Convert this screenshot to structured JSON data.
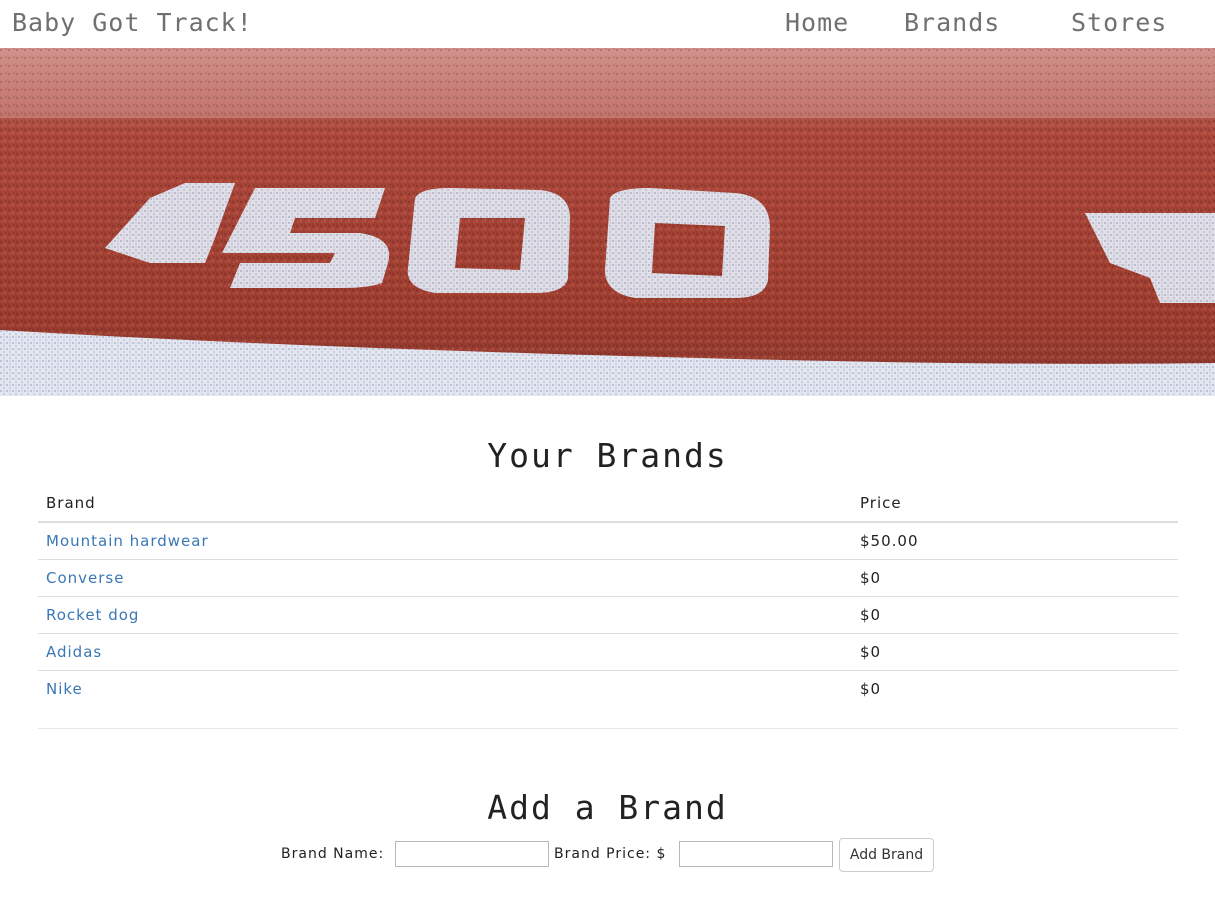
{
  "navbar": {
    "title": "Baby Got Track!",
    "links": [
      {
        "label": "Home"
      },
      {
        "label": "Brands"
      },
      {
        "label": "Stores"
      }
    ]
  },
  "hero": {
    "track_number": "1500",
    "colors": {
      "track": "#a84b3e",
      "paint": "#e9ecf3"
    }
  },
  "brands_section": {
    "heading": "Your Brands",
    "columns": [
      "Brand",
      "Price"
    ],
    "rows": [
      {
        "brand": "Mountain hardwear",
        "price": "$50.00"
      },
      {
        "brand": "Converse",
        "price": "$0"
      },
      {
        "brand": "Rocket dog",
        "price": "$0"
      },
      {
        "brand": "Adidas",
        "price": "$0"
      },
      {
        "brand": "Nike",
        "price": "$0"
      }
    ]
  },
  "add_section": {
    "heading": "Add a Brand",
    "name_label": "Brand Name:",
    "price_label": "Brand Price: $",
    "name_value": "",
    "price_value": "",
    "button_label": "Add Brand"
  },
  "colors": {
    "nav_text": "#707070",
    "link": "#3a77b5",
    "text": "#222222",
    "rule": "#dddddd"
  }
}
